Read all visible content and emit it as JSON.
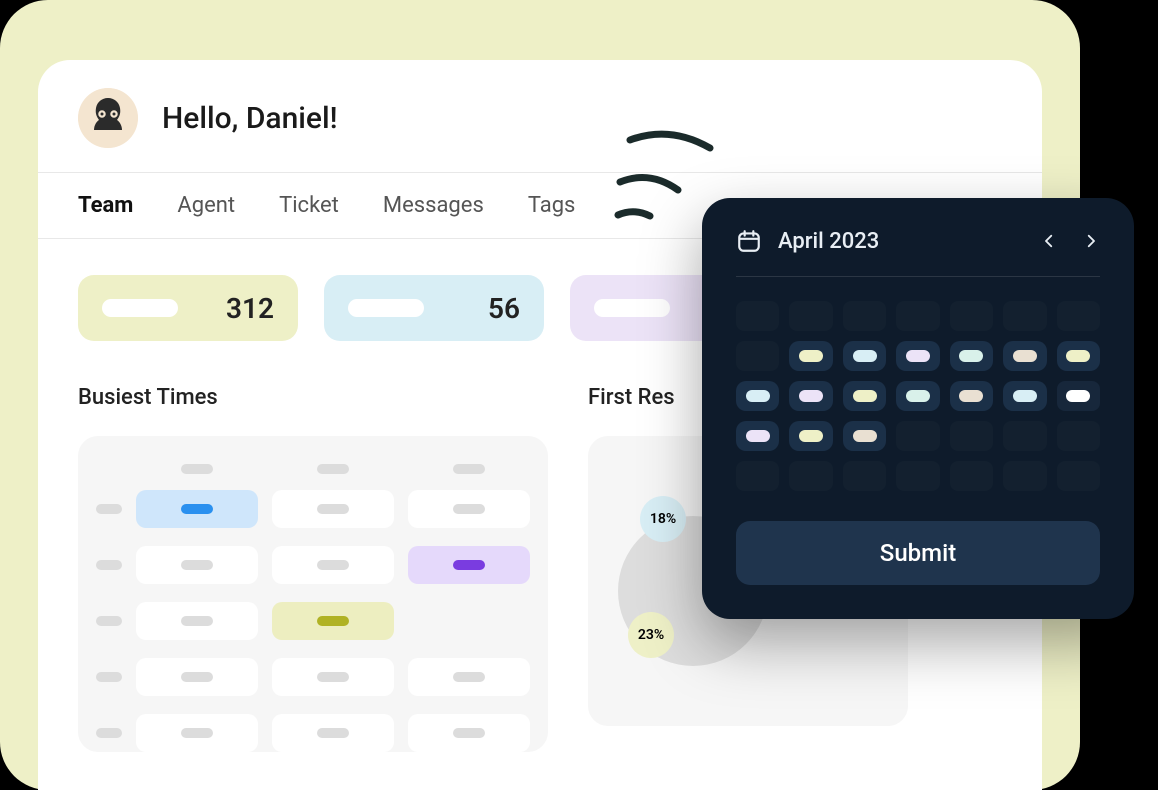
{
  "greeting": "Hello, Daniel!",
  "tabs": [
    "Team",
    "Agent",
    "Ticket",
    "Messages",
    "Tags"
  ],
  "active_tab": 0,
  "stats": [
    {
      "value": "312",
      "color": "#eef0c7"
    },
    {
      "value": "56",
      "color": "#d8eef5"
    },
    {
      "value": "",
      "color": "#ece3f7"
    }
  ],
  "panels": {
    "busiest_label": "Busiest Times",
    "first_response_label": "First Res",
    "donut_badges": [
      "18%",
      "23%"
    ]
  },
  "calendar": {
    "title": "April 2023",
    "submit_label": "Submit"
  }
}
